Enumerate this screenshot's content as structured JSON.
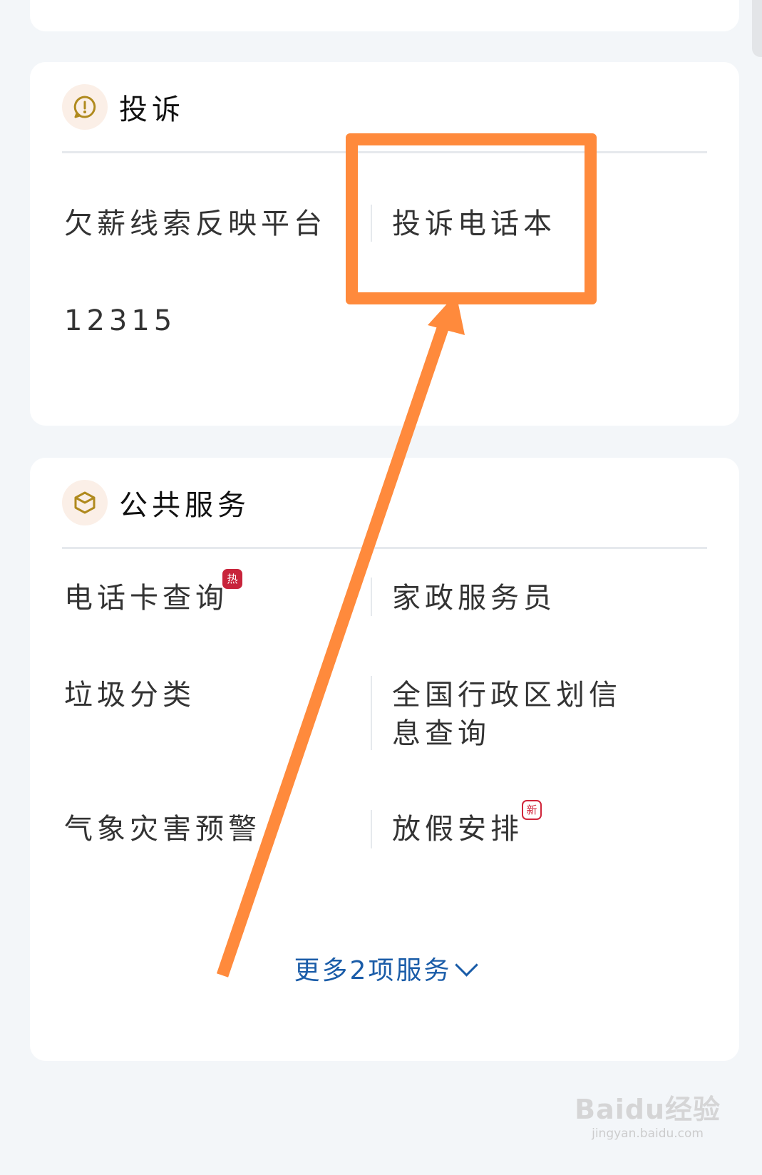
{
  "complaint": {
    "title": "投诉",
    "items": [
      {
        "label": "欠薪线索反映平台"
      },
      {
        "label": "投诉电话本"
      },
      {
        "label": "12315"
      }
    ]
  },
  "public_service": {
    "title": "公共服务",
    "items": [
      {
        "label": "电话卡查询",
        "badge": "热"
      },
      {
        "label": "家政服务员"
      },
      {
        "label": "垃圾分类"
      },
      {
        "label": "全国行政区划信息查询"
      },
      {
        "label": "气象灾害预警"
      },
      {
        "label": "放假安排",
        "badge": "新"
      }
    ],
    "more_label": "更多2项服务"
  },
  "colors": {
    "highlight": "#ff8a3c",
    "link": "#1a5ca8",
    "badge_hot": "#c8243b",
    "icon_gold": "#b08a1e"
  },
  "watermark": {
    "brand": "Baidu经验",
    "url": "jingyan.baidu.com"
  }
}
